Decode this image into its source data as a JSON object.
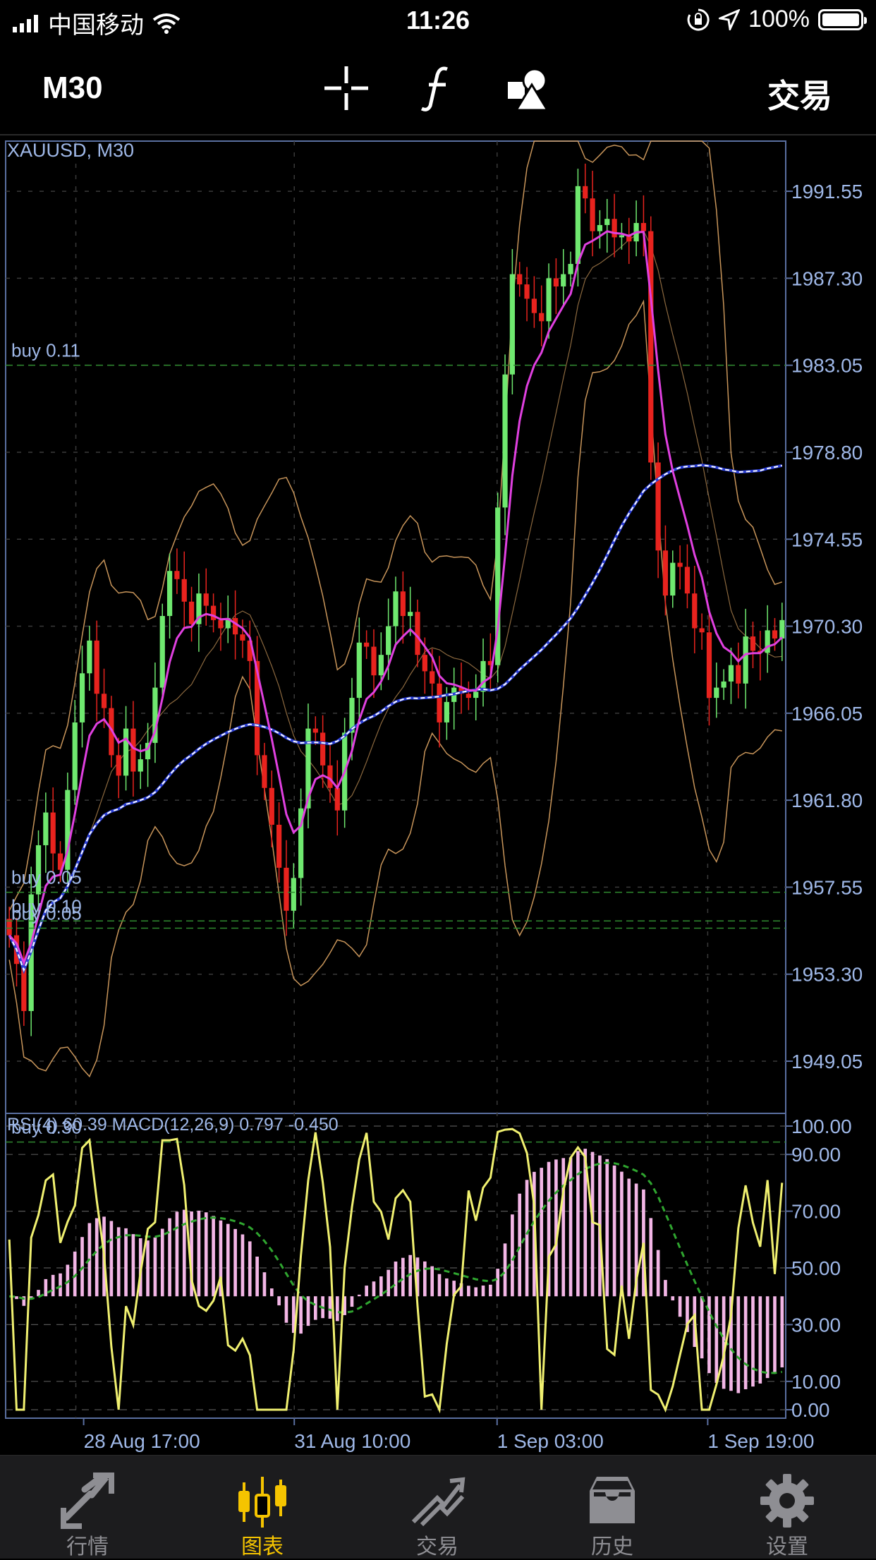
{
  "status_bar": {
    "carrier": "中国移动",
    "time": "11:26",
    "battery": "100%"
  },
  "toolbar": {
    "period": "M30",
    "trade_label": "交易",
    "icons": [
      "crosshair-icon",
      "function-icon",
      "objects-icon"
    ]
  },
  "chart": {
    "symbol_label": "XAUUSD, M30",
    "price_ticks": [
      "1991.55",
      "1987.30",
      "1983.05",
      "1978.80",
      "1974.55",
      "1970.30",
      "1966.05",
      "1961.80",
      "1957.55",
      "1953.30",
      "1949.05"
    ],
    "orders": [
      {
        "label": "buy 0.11",
        "price": 1983.05
      },
      {
        "label": "buy 0.05",
        "price": 1957.3
      },
      {
        "label": "buy 0.10",
        "price": 1955.9
      },
      {
        "label": "buy 0.05",
        "price": 1955.55
      },
      {
        "label": "buy 0.30",
        "price": 1945.1
      }
    ],
    "indicator_label": "RSI(4) 60.39 MACD(12,26,9) 0.797 -0.450",
    "indicator_ticks": [
      "100.00",
      "90.00",
      "70.00",
      "50.00",
      "30.00",
      "10.00",
      "0.00"
    ],
    "time_labels": [
      "28 Aug 17:00",
      "31 Aug 10:00",
      "1 Sep 03:00",
      "1 Sep 19:00"
    ],
    "colors": {
      "bull": "#6fe86f",
      "bear": "#e8231e",
      "ma_fast": "#e040e0",
      "ma_slow": "#ffffff",
      "bands": "#c8955a",
      "rsi": "#f0f070",
      "macd_hist": "#f3b6e6",
      "macd_signal": "#2fa52f",
      "axis_text": "#9fb8e8",
      "grid": "#3a3a3a"
    }
  },
  "chart_data": {
    "type": "candlestick",
    "symbol": "XAUUSD",
    "timeframe": "M30",
    "ylim": [
      1946.5,
      1994.0
    ],
    "close_series": [
      1955.2,
      1953.8,
      1951.5,
      1957.2,
      1959.6,
      1961.2,
      1959.2,
      1958.4,
      1962.3,
      1965.6,
      1968.0,
      1969.6,
      1967.0,
      1966.3,
      1964.0,
      1963.0,
      1965.3,
      1963.2,
      1963.8,
      1964.6,
      1967.3,
      1970.8,
      1973.0,
      1972.6,
      1971.5,
      1970.4,
      1971.9,
      1971.3,
      1970.6,
      1970.2,
      1970.7,
      1969.9,
      1969.6,
      1968.6,
      1964.0,
      1962.4,
      1960.6,
      1958.5,
      1956.4,
      1958.0,
      1961.4,
      1965.3,
      1965.1,
      1963.5,
      1962.4,
      1961.3,
      1965.1,
      1966.8,
      1969.5,
      1969.3,
      1967.9,
      1968.9,
      1970.3,
      1972.0,
      1970.8,
      1971.0,
      1968.9,
      1968.1,
      1967.5,
      1965.6,
      1966.6,
      1967.3,
      1967.0,
      1966.8,
      1967.1,
      1968.6,
      1968.4,
      1976.1,
      1982.6,
      1987.5,
      1987.0,
      1986.3,
      1985.6,
      1985.2,
      1987.3,
      1986.9,
      1987.5,
      1988.0,
      1991.8,
      1991.2,
      1989.6,
      1989.9,
      1990.2,
      1989.3,
      1989.4,
      1989.1,
      1990.0,
      1989.6,
      1978.3,
      1974.0,
      1971.8,
      1973.4,
      1973.2,
      1971.9,
      1970.2,
      1970.0,
      1966.8,
      1967.3,
      1967.6,
      1968.4,
      1967.5,
      1969.8,
      1969.1,
      1969.0,
      1970.1,
      1969.7,
      1970.6
    ],
    "indicators": {
      "RSI_4": 60.39,
      "MACD_12_26_9": [
        0.797,
        -0.45
      ]
    },
    "order_lines": [
      {
        "side": "buy",
        "volume": 0.11,
        "price": 1983.05
      },
      {
        "side": "buy",
        "volume": 0.05,
        "price": 1957.3
      },
      {
        "side": "buy",
        "volume": 0.1,
        "price": 1955.9
      },
      {
        "side": "buy",
        "volume": 0.05,
        "price": 1955.55
      },
      {
        "side": "buy",
        "volume": 0.3,
        "price": 1945.1
      }
    ],
    "x_labels": [
      "28 Aug 17:00",
      "31 Aug 10:00",
      "1 Sep 03:00",
      "1 Sep 19:00"
    ],
    "grid": true
  },
  "tabbar": {
    "tabs": [
      {
        "label": "行情",
        "icon": "quotes-icon",
        "active": false
      },
      {
        "label": "图表",
        "icon": "chart-icon",
        "active": true
      },
      {
        "label": "交易",
        "icon": "trade-icon",
        "active": false
      },
      {
        "label": "历史",
        "icon": "history-icon",
        "active": false
      },
      {
        "label": "设置",
        "icon": "settings-icon",
        "active": false
      }
    ]
  }
}
